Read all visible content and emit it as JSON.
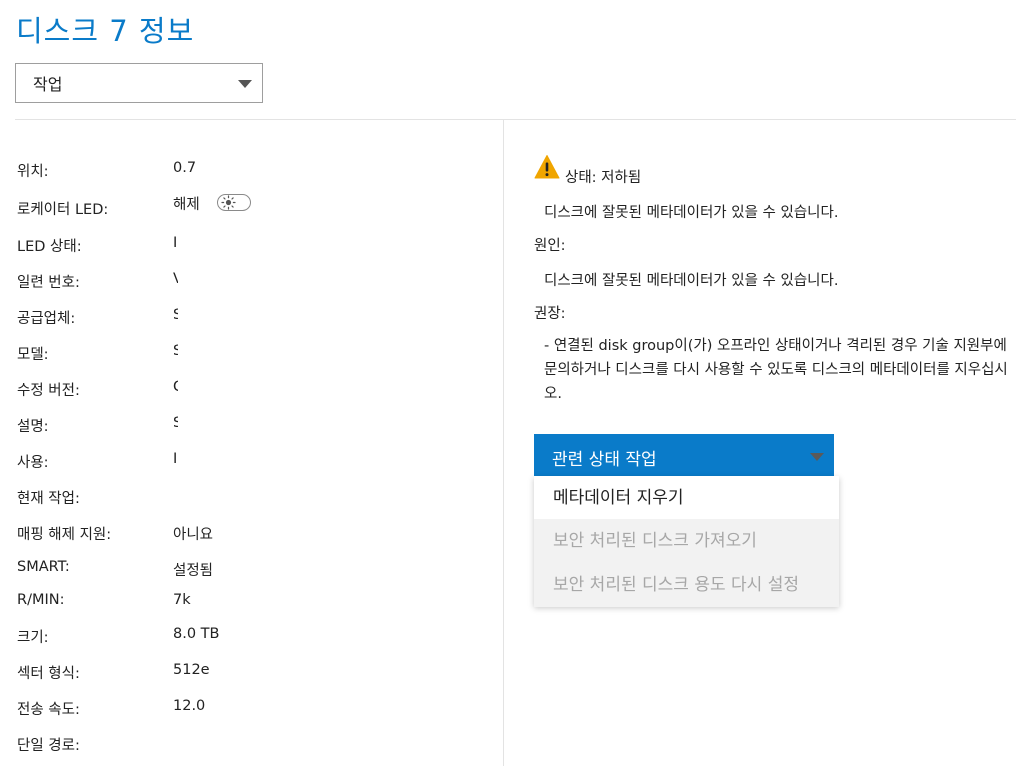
{
  "page": {
    "title": "디스크 7 정보"
  },
  "action_select": {
    "label": "작업"
  },
  "properties": [
    {
      "label": "위치:",
      "value": "0.7"
    },
    {
      "label": "로케이터 LED:",
      "value": "해제"
    },
    {
      "label": "LED 상태:",
      "value": "I"
    },
    {
      "label": "일련 번호:",
      "value": "V"
    },
    {
      "label": "공급업체:",
      "value": "S"
    },
    {
      "label": "모델:",
      "value": "S"
    },
    {
      "label": "수정 버전:",
      "value": "C"
    },
    {
      "label": "설명:",
      "value": "S"
    },
    {
      "label": "사용:",
      "value": "I"
    },
    {
      "label": "현재 작업:",
      "value": ""
    },
    {
      "label": "매핑 해제 지원:",
      "value": "아니요"
    },
    {
      "label": "SMART:",
      "value": "설정됨"
    },
    {
      "label": "R/MIN:",
      "value": "7k"
    },
    {
      "label": "크기:",
      "value": "8.0 TB"
    },
    {
      "label": "섹터 형식:",
      "value": "512e"
    },
    {
      "label": "전송 속도:",
      "value": "12.0"
    },
    {
      "label": "단일 경로:",
      "value": ""
    }
  ],
  "status": {
    "icon": "warning-icon",
    "status_text": "상태: 저하됨",
    "description": "디스크에 잘못된 메타데이터가 있을 수 있습니다.",
    "cause_label": "원인:",
    "cause_text": "디스크에 잘못된 메타데이터가 있을 수 있습니다.",
    "recommendation_label": "권장:",
    "recommendation_text": "- 연결된 disk group이(가) 오프라인 상태이거나 격리된 경우 기술 지원부에 문의하거나 디스크를 다시 사용할 수 있도록 디스크의 메타데이터를 지우십시오."
  },
  "health_actions": {
    "button_label": "관련 상태 작업",
    "items": [
      {
        "label": "메타데이터 지우기",
        "enabled": true
      },
      {
        "label": "보안 처리된 디스크 가져오기",
        "enabled": false
      },
      {
        "label": "보안 처리된 디스크 용도 다시 설정",
        "enabled": false
      }
    ]
  },
  "colors": {
    "accent": "#0a7bc9",
    "warning": "#f0a500",
    "disabled_text": "#a7a7a7",
    "disabled_bg": "#f2f2f2"
  }
}
